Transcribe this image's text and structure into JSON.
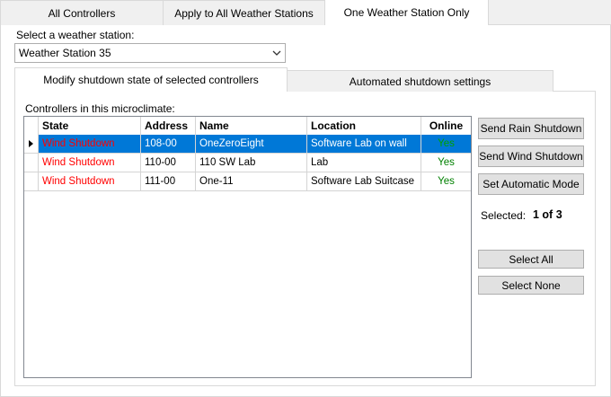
{
  "top_tabs": [
    {
      "label": "All Controllers",
      "active": false
    },
    {
      "label": "Apply to All Weather Stations",
      "active": false
    },
    {
      "label": "One Weather Station Only",
      "active": true
    }
  ],
  "station": {
    "label": "Select a weather station:",
    "selected": "Weather Station 35",
    "arrow_icon": "chevron-down-icon"
  },
  "inner_tabs": [
    {
      "label": "Modify shutdown state of selected controllers",
      "active": true
    },
    {
      "label": "Automated shutdown settings",
      "active": false
    }
  ],
  "controllers_label": "Controllers in this microclimate:",
  "grid": {
    "columns": [
      "State",
      "Address",
      "Name",
      "Location",
      "Online"
    ],
    "rows": [
      {
        "state": "Wind Shutdown",
        "address": "108-00",
        "name": "OneZeroEight",
        "location": "Software Lab on wall",
        "online": "Yes",
        "selected": true
      },
      {
        "state": "Wind Shutdown",
        "address": "110-00",
        "name": "110 SW Lab",
        "location": "Lab",
        "online": "Yes",
        "selected": false
      },
      {
        "state": "Wind Shutdown",
        "address": "111-00",
        "name": "One-11",
        "location": "Software Lab Suitcase",
        "online": "Yes",
        "selected": false
      }
    ]
  },
  "buttons": {
    "send_rain": "Send Rain Shutdown",
    "send_wind": "Send Wind Shutdown",
    "set_auto": "Set Automatic Mode",
    "select_all": "Select All",
    "select_none": "Select None"
  },
  "selected_label": "Selected:",
  "selected_value": "1 of 3",
  "colors": {
    "selection": "#0078d7",
    "state_text": "#ff0000",
    "online_text": "#008000"
  }
}
